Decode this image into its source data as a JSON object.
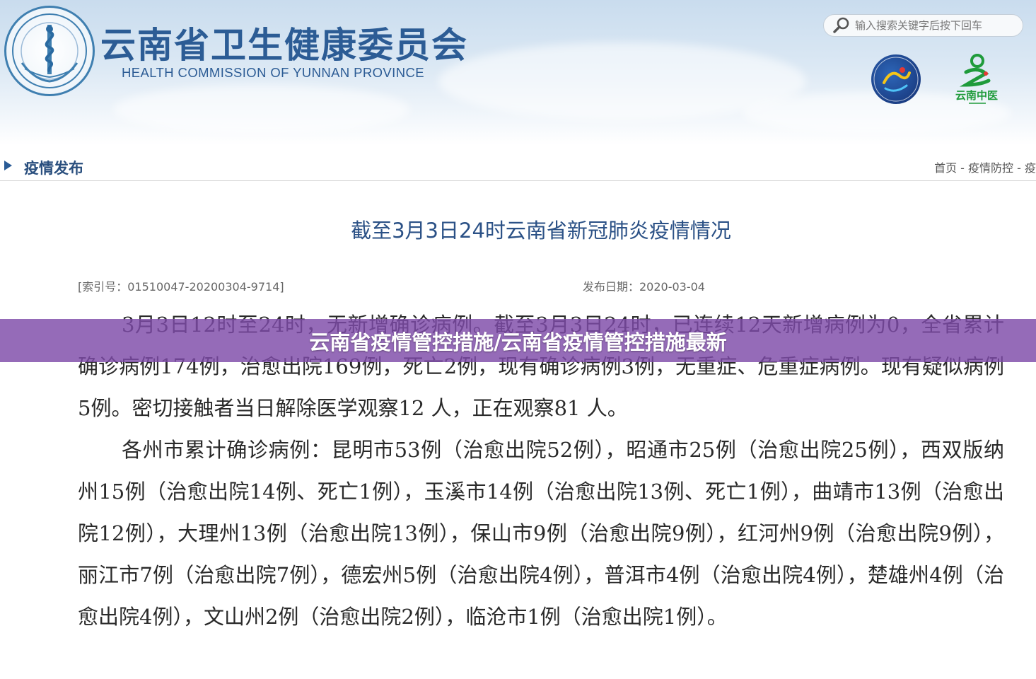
{
  "header": {
    "site_title": "云南省卫生健康委员会",
    "site_subtitle": "HEALTH COMMISSION OF YUNNAN PROVINCE",
    "search_placeholder": "输入搜索关键字后按下回车",
    "logo_tcm_text": "云南中医"
  },
  "section": {
    "title": "疫情发布",
    "breadcrumb": "首页 - 疫情防控 - 疫"
  },
  "article": {
    "title": "截至3月3日24时云南省新冠肺炎疫情情况",
    "index_no": "[索引号：01510047-20200304-9714]",
    "publish_date": "发布日期：2020-03-04",
    "paragraph_1": "3月3日12时至24时，无新增确诊病例。截至3月3日24时，已连续12天新增病例为0，全省累计确诊病例174例，治愈出院169例，死亡2例，现有确诊病例3例，无重症、危重症病例。现有疑似病例5例。密切接触者当日解除医学观察12 人，正在观察81 人。",
    "paragraph_2": "各州市累计确诊病例：昆明市53例（治愈出院52例），昭通市25例（治愈出院25例），西双版纳州15例（治愈出院14例、死亡1例），玉溪市14例（治愈出院13例、死亡1例），曲靖市13例（治愈出院12例），大理州13例（治愈出院13例），保山市9例（治愈出院9例），红河州9例（治愈出院9例），丽江市7例（治愈出院7例），德宏州5例（治愈出院4例），普洱市4例（治愈出院4例），楚雄州4例（治愈出院4例），文山州2例（治愈出院2例），临沧市1例（治愈出院1例）。"
  },
  "banner": {
    "text": "云南省疫情管控措施/云南省疫情管控措施最新"
  },
  "colors": {
    "brand_blue": "#2c5c95",
    "banner_purple": "#7e4aa8"
  }
}
